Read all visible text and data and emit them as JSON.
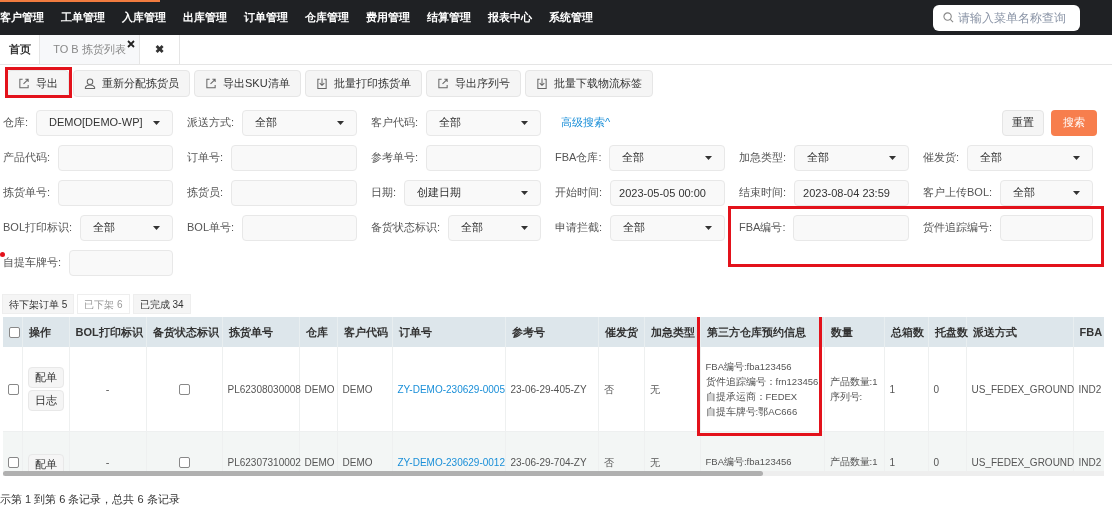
{
  "top_menu": {
    "items": [
      "客户管理",
      "工单管理",
      "入库管理",
      "出库管理",
      "订单管理",
      "仓库管理",
      "费用管理",
      "结算管理",
      "报表中心",
      "系统管理"
    ],
    "search": {
      "placeholder": "请输入菜单名称查询"
    }
  },
  "page_tabs": [
    {
      "label": "首页",
      "selected": false,
      "closable": false
    },
    {
      "label": "TO B 拣货列表",
      "selected": true,
      "closable": true
    },
    {
      "label": "✖",
      "selected": false,
      "closable": false
    }
  ],
  "toolbar": [
    {
      "label": "导出",
      "kind": "export",
      "highlighted": true
    },
    {
      "label": "重新分配拣货员",
      "kind": "user",
      "highlighted": false
    },
    {
      "label": "导出SKU清单",
      "kind": "export",
      "highlighted": false
    },
    {
      "label": "批量打印拣货单",
      "kind": "download",
      "highlighted": false
    },
    {
      "label": "导出序列号",
      "kind": "export",
      "highlighted": false
    },
    {
      "label": "批量下载物流标签",
      "kind": "download",
      "highlighted": false
    }
  ],
  "filters": {
    "rows": [
      [
        {
          "label": "仓库:",
          "kind": "select",
          "value": "DEMO[DEMO-WP]"
        },
        {
          "label": "派送方式:",
          "kind": "select",
          "value": "全部"
        },
        {
          "label": "客户代码:",
          "kind": "select",
          "value": "全部"
        }
      ],
      [
        {
          "label": "产品代码:",
          "kind": "input"
        },
        {
          "label": "订单号:",
          "kind": "input"
        },
        {
          "label": "参考单号:",
          "kind": "input"
        },
        {
          "label": "FBA仓库:",
          "kind": "select",
          "value": "全部"
        },
        {
          "label": "加急类型:",
          "kind": "select",
          "value": "全部"
        },
        {
          "label": "催发货:",
          "kind": "select",
          "value": "全部"
        }
      ],
      [
        {
          "label": "拣货单号:",
          "kind": "input"
        },
        {
          "label": "拣货员:",
          "kind": "input"
        },
        {
          "label": "日期:",
          "kind": "select",
          "value": "创建日期"
        },
        {
          "label": "开始时间:",
          "kind": "input",
          "value": "2023-05-05 00:00"
        },
        {
          "label": "结束时间:",
          "kind": "input",
          "value": "2023-08-04 23:59"
        },
        {
          "label": "客户上传BOL:",
          "kind": "select",
          "value": "全部"
        }
      ],
      [
        {
          "label": "BOL打印标识:",
          "kind": "select",
          "value": "全部"
        },
        {
          "label": "BOL单号:",
          "kind": "input"
        },
        {
          "label": "备货状态标识:",
          "kind": "select",
          "value": "全部"
        },
        {
          "label": "申请拦截:",
          "kind": "select",
          "value": "全部"
        },
        {
          "label": "FBA编号:",
          "kind": "input",
          "highlighted": true
        },
        {
          "label": "货件追踪编号:",
          "kind": "input",
          "highlighted": true
        }
      ],
      [
        {
          "label": "自提车牌号:",
          "kind": "input",
          "marked": true
        }
      ]
    ],
    "advanced_link": "高级搜索^",
    "reset_button": "重置",
    "search_button": "搜索"
  },
  "status_tabs": [
    {
      "label": "待下架订单 5",
      "selected": false
    },
    {
      "label": "已下架 6",
      "selected": true
    },
    {
      "label": "已完成 34",
      "selected": false
    }
  ],
  "table": {
    "columns": [
      {
        "kind": "select",
        "checked": false
      },
      {
        "label": "操作",
        "kind": "actions"
      },
      {
        "label": "BOL打印标识",
        "kind": "center"
      },
      {
        "label": "备货状态标识",
        "kind": "checkbox"
      },
      {
        "label": "拣货单号",
        "kind": "text"
      },
      {
        "label": "仓库",
        "kind": "text"
      },
      {
        "label": "客户代码",
        "kind": "text"
      },
      {
        "label": "订单号",
        "kind": "link"
      },
      {
        "label": "参考号",
        "kind": "text"
      },
      {
        "label": "催发货",
        "kind": "text"
      },
      {
        "label": "加急类型",
        "kind": "text"
      },
      {
        "label": "第三方仓库预约信息",
        "kind": "lines",
        "highlighted": true
      },
      {
        "label": "数量",
        "kind": "lines"
      },
      {
        "label": "总箱数",
        "kind": "text"
      },
      {
        "label": "托盘数",
        "kind": "text"
      },
      {
        "label": "派送方式",
        "kind": "text"
      },
      {
        "label": "FBA",
        "kind": "text"
      }
    ],
    "rows": [
      {
        "cells": [
          false,
          [
            "配单",
            "日志"
          ],
          "-",
          false,
          "PL62308030008",
          "DEMO",
          "DEMO",
          "ZY-DEMO-230629-0005",
          "23-06-29-405-ZY",
          "否",
          "无",
          [
            "FBA编号:fba123456",
            "货件追踪编号：frn123456",
            "自提承运商：FEDEX",
            "自提车牌号:鄂AC666"
          ],
          [
            "产品数量:1",
            "序列号:"
          ],
          "1",
          "0",
          "US_FEDEX_GROUND",
          "IND2"
        ]
      },
      {
        "cells": [
          false,
          [
            "配单"
          ],
          "-",
          false,
          "PL62307310002",
          "DEMO",
          "DEMO",
          "ZY-DEMO-230629-0012",
          "23-06-29-704-ZY",
          "否",
          "无",
          [
            "FBA编号:fba123456"
          ],
          [
            "产品数量:1"
          ],
          "1",
          "0",
          "US_FEDEX_GROUND",
          "IND2"
        ]
      }
    ]
  },
  "footer": "示第 1 到第 6 条记录，总共 6 条记录"
}
